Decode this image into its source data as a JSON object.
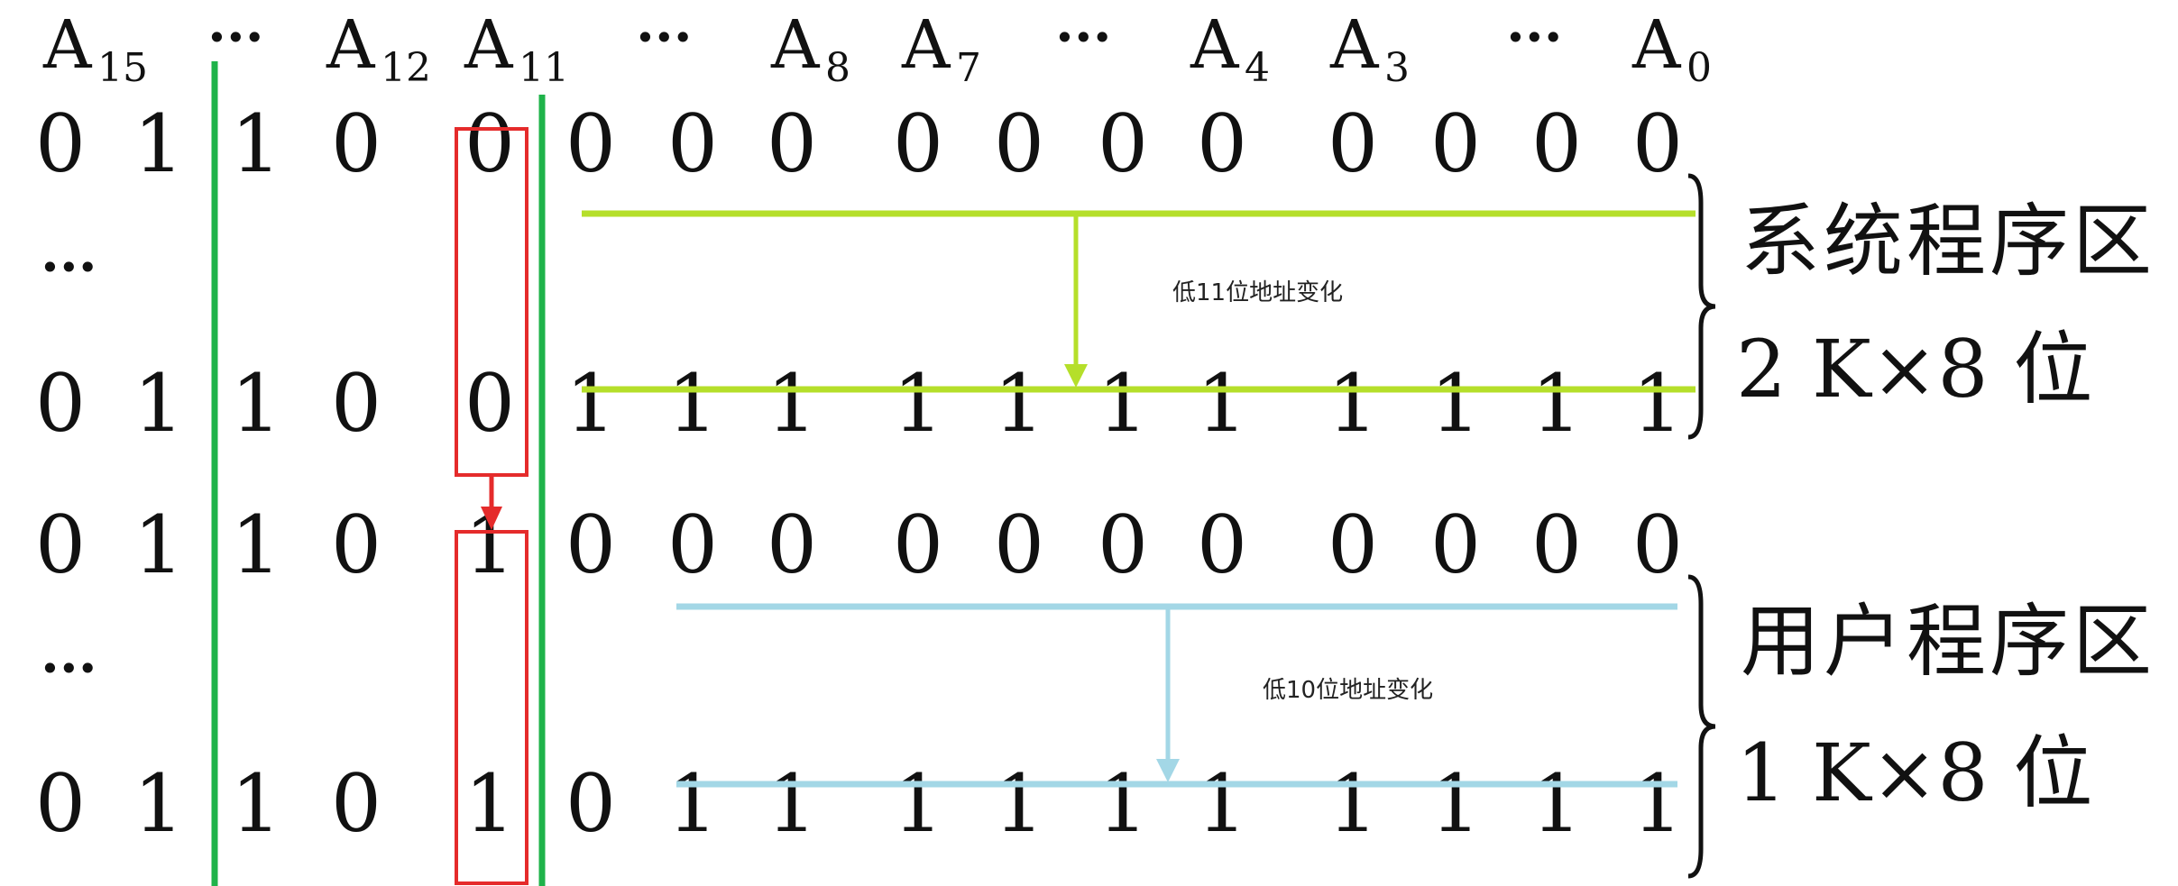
{
  "header": {
    "cells": [
      {
        "type": "addr",
        "letter": "A",
        "sub": "15"
      },
      {
        "type": "dots",
        "text": "···"
      },
      {
        "type": "addr",
        "letter": "A",
        "sub": "12"
      },
      {
        "type": "addr",
        "letter": "A",
        "sub": "11"
      },
      {
        "type": "dots",
        "text": "···"
      },
      {
        "type": "addr",
        "letter": "A",
        "sub": "8"
      },
      {
        "type": "addr",
        "letter": "A",
        "sub": "7"
      },
      {
        "type": "dots",
        "text": "···"
      },
      {
        "type": "addr",
        "letter": "A",
        "sub": "4"
      },
      {
        "type": "addr",
        "letter": "A",
        "sub": "3"
      },
      {
        "type": "dots",
        "text": "···"
      },
      {
        "type": "addr",
        "letter": "A",
        "sub": "0"
      }
    ]
  },
  "rows": [
    {
      "type": "bits",
      "bits": [
        "0",
        "1",
        "1",
        "0",
        "0",
        "0",
        "0",
        "0",
        "0",
        "0",
        "0",
        "0",
        "0",
        "0",
        "0",
        "0"
      ]
    },
    {
      "type": "ellipsis",
      "text": "···"
    },
    {
      "type": "bits",
      "bits": [
        "0",
        "1",
        "1",
        "0",
        "0",
        "1",
        "1",
        "1",
        "1",
        "1",
        "1",
        "1",
        "1",
        "1",
        "1",
        "1"
      ]
    },
    {
      "type": "bits",
      "bits": [
        "0",
        "1",
        "1",
        "0",
        "1",
        "0",
        "0",
        "0",
        "0",
        "0",
        "0",
        "0",
        "0",
        "0",
        "0",
        "0"
      ]
    },
    {
      "type": "ellipsis",
      "text": "···"
    },
    {
      "type": "bits",
      "bits": [
        "0",
        "1",
        "1",
        "0",
        "1",
        "0",
        "1",
        "1",
        "1",
        "1",
        "1",
        "1",
        "1",
        "1",
        "1",
        "1"
      ]
    }
  ],
  "regions": [
    {
      "name": "系统程序区",
      "capacity": "2 K×8 位",
      "note": "低11位地址变化",
      "color": "#b5df2a"
    },
    {
      "name": "用户程序区",
      "capacity": "1 K×8 位",
      "note": "低10位地址变化",
      "color": "#a3d7e6"
    }
  ],
  "colors": {
    "divider": "#1fb34a",
    "highlight": "#e52b2b",
    "text": "#111111"
  }
}
